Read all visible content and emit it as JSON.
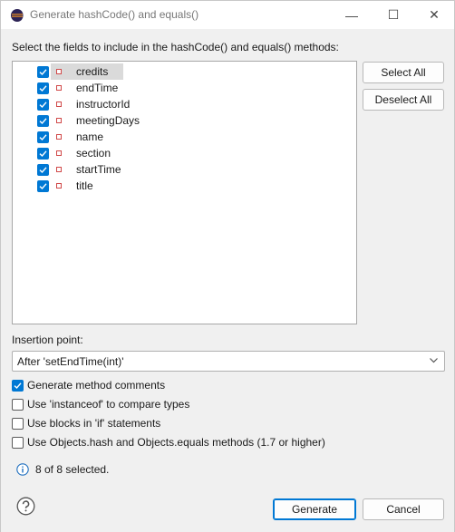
{
  "window": {
    "title": "Generate hashCode() and equals()",
    "minimize_glyph": "—",
    "maximize_glyph": "☐",
    "close_glyph": "✕"
  },
  "instructions": "Select the fields to include in the hashCode() and equals() methods:",
  "fields": [
    {
      "name": "credits",
      "checked": true,
      "selected": true
    },
    {
      "name": "endTime",
      "checked": true
    },
    {
      "name": "instructorId",
      "checked": true
    },
    {
      "name": "meetingDays",
      "checked": true
    },
    {
      "name": "name",
      "checked": true
    },
    {
      "name": "section",
      "checked": true
    },
    {
      "name": "startTime",
      "checked": true
    },
    {
      "name": "title",
      "checked": true
    }
  ],
  "buttons": {
    "select_all": "Select All",
    "deselect_all": "Deselect All",
    "generate": "Generate",
    "cancel": "Cancel"
  },
  "insertion": {
    "label": "Insertion point:",
    "value": "After 'setEndTime(int)'"
  },
  "options": [
    {
      "label": "Generate method comments",
      "checked": true
    },
    {
      "label": "Use 'instanceof' to compare types",
      "checked": false
    },
    {
      "label": "Use blocks in 'if' statements",
      "checked": false
    },
    {
      "label": "Use Objects.hash and Objects.equals methods (1.7 or higher)",
      "checked": false
    }
  ],
  "status": "8 of 8 selected.",
  "colors": {
    "accent": "#0078d4",
    "field_icon": "#d04848",
    "background": "#f0f0f0"
  },
  "icons": {
    "app": "eclipse-icon",
    "field": "field-private-icon",
    "info": "info-icon",
    "help": "help-icon",
    "dropdown": "chevron-down-icon"
  }
}
